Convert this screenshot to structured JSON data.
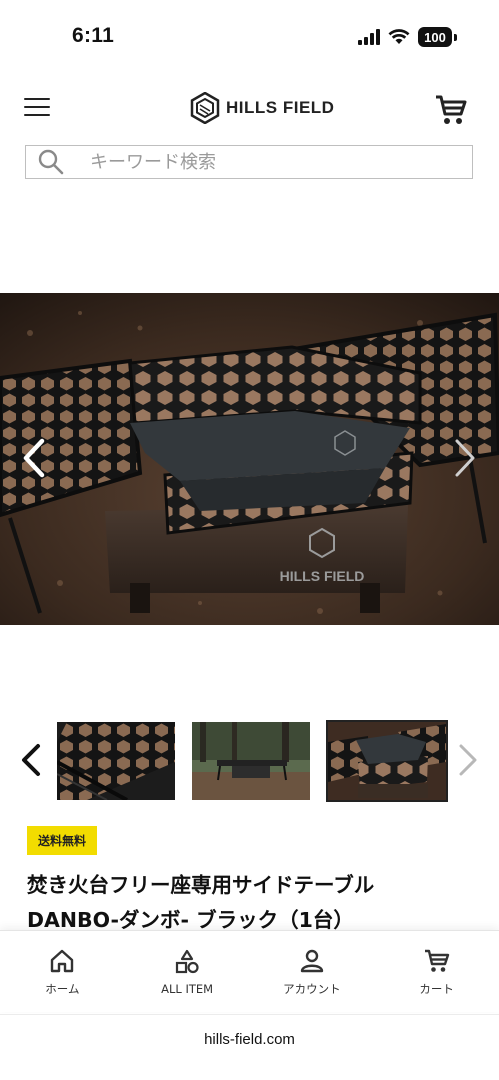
{
  "status_bar": {
    "time": "6:11",
    "battery": "100"
  },
  "header": {
    "logo_text": "HILLS FIELD"
  },
  "search": {
    "placeholder": "キーワード検索"
  },
  "hero": {
    "watermark": "HILLS FIELD"
  },
  "badge": {
    "label": "送料無料"
  },
  "product": {
    "title": "焚き火台フリー座専用サイドテーブル DANBO-ダンボ- ブラック（1台）"
  },
  "bottom_nav": {
    "items": [
      {
        "label": "ホーム",
        "icon": "home-icon"
      },
      {
        "label": "ALL ITEM",
        "icon": "shapes-icon"
      },
      {
        "label": "アカウント",
        "icon": "person-icon"
      },
      {
        "label": "カート",
        "icon": "cart-icon"
      }
    ]
  },
  "browser": {
    "url": "hills-field.com"
  }
}
